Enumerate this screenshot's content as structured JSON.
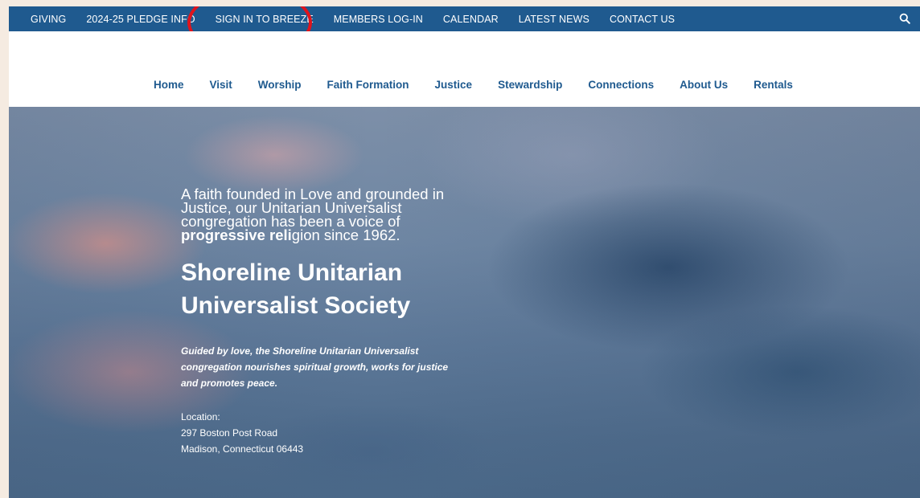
{
  "topbar": {
    "links": [
      "GIVING",
      "2024-25 PLEDGE INFO",
      "SIGN IN TO BREEZE",
      "MEMBERS LOG-IN",
      "CALENDAR",
      "LATEST NEWS",
      "CONTACT US"
    ],
    "search_icon": "search-icon"
  },
  "mainnav": {
    "items": [
      "Home",
      "Visit",
      "Worship",
      "Faith Formation",
      "Justice",
      "Stewardship",
      "Connections",
      "About Us",
      "Rentals"
    ]
  },
  "hero": {
    "tagline_part1": "A faith founded in Love and grounded in Justice, our Unitarian Universalist congregation has been a voice of ",
    "tagline_bold1": "progressive reli",
    "tagline_part2": "gion since 1962.",
    "title_line1": "Shoreline Unitarian",
    "title_line2": "Universalist Society",
    "mission": "Guided by love, the Shoreline Unitarian Universalist congregation nourishes spiritual growth, works for justice and promotes peace.",
    "location_label": "Location:",
    "address_line1": "297 Boston Post Road",
    "address_line2": "Madison, Connecticut 06443"
  },
  "colors": {
    "topbar": "#1f5a8f",
    "nav_text": "#1f5a8f",
    "annotation": "#e0141c"
  }
}
